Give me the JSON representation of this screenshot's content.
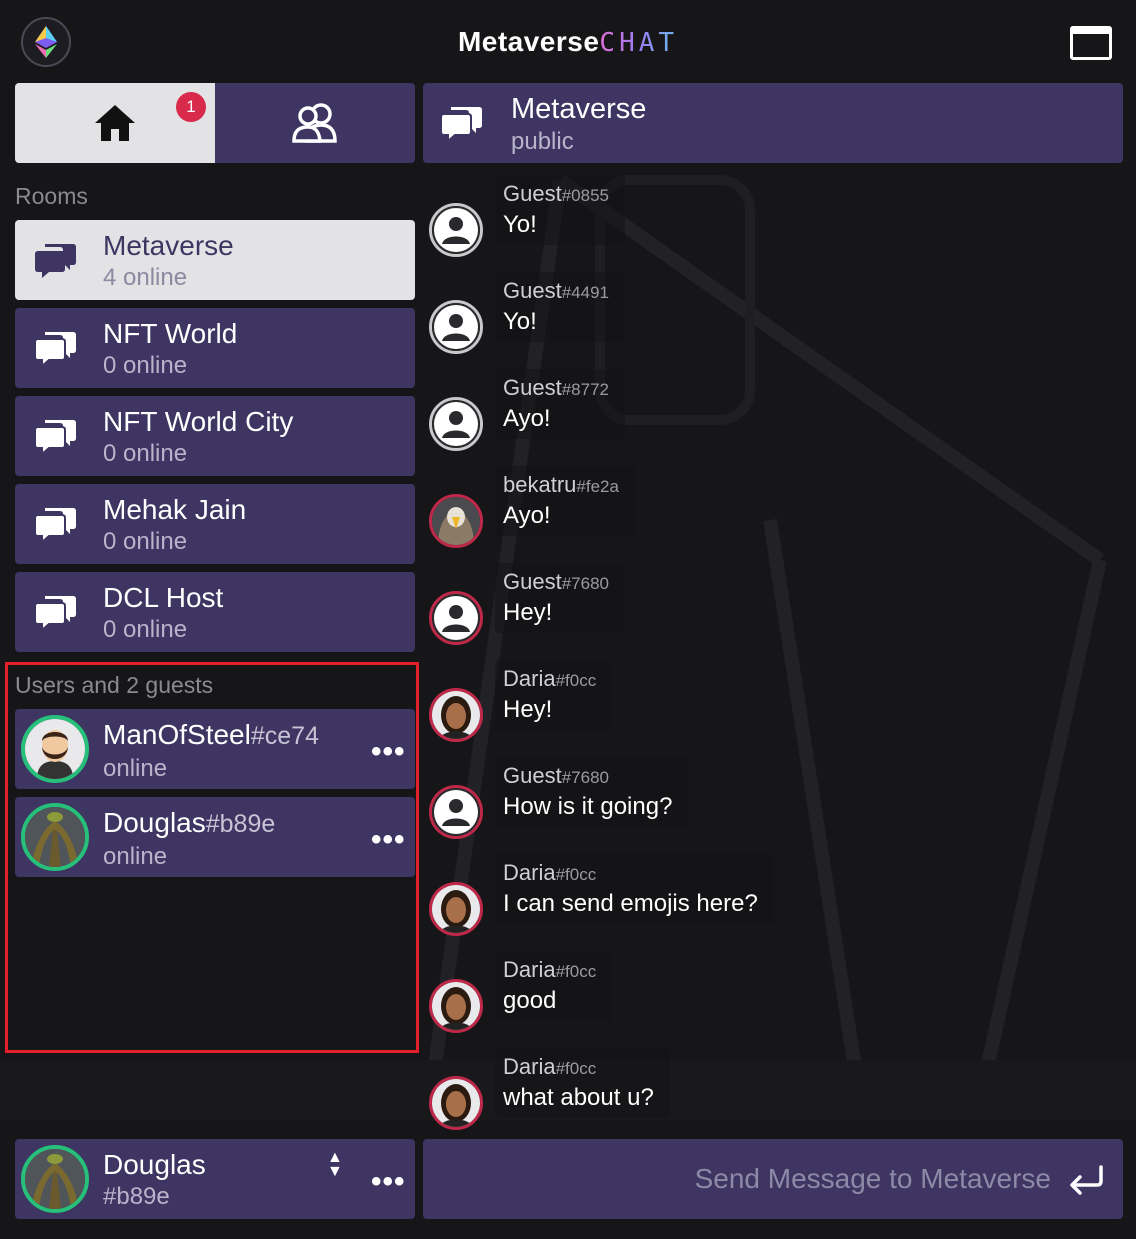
{
  "header": {
    "title_main": "Metaverse",
    "title_accent": "CHAT"
  },
  "nav": {
    "home_badge": "1"
  },
  "rooms": {
    "label": "Rooms",
    "items": [
      {
        "name": "Metaverse",
        "status": "4 online"
      },
      {
        "name": "NFT World",
        "status": "0 online"
      },
      {
        "name": "NFT World City",
        "status": "0 online"
      },
      {
        "name": "Mehak Jain",
        "status": "0 online"
      },
      {
        "name": "DCL Host",
        "status": "0 online"
      }
    ]
  },
  "users": {
    "label": "Users and 2 guests",
    "items": [
      {
        "name": "ManOfSteel",
        "tag": "#ce74",
        "status": "online",
        "menu": "•••"
      },
      {
        "name": "Douglas",
        "tag": "#b89e",
        "status": "online",
        "menu": "•••"
      }
    ]
  },
  "current_user": {
    "name": "Douglas",
    "tag": "#b89e",
    "menu": "•••"
  },
  "chat": {
    "room_name": "Metaverse",
    "room_type": "public",
    "messages": [
      {
        "author": "Guest",
        "tag": "#0855",
        "text": "Yo!"
      },
      {
        "author": "Guest",
        "tag": "#4491",
        "text": "Yo!"
      },
      {
        "author": "Guest",
        "tag": "#8772",
        "text": "Ayo!"
      },
      {
        "author": "bekatru",
        "tag": "#fe2a",
        "text": "Ayo!"
      },
      {
        "author": "Guest",
        "tag": "#7680",
        "text": "Hey!"
      },
      {
        "author": "Daria",
        "tag": "#f0cc",
        "text": "Hey!"
      },
      {
        "author": "Guest",
        "tag": "#7680",
        "text": "How is it going?"
      },
      {
        "author": "Daria",
        "tag": "#f0cc",
        "text": "I can  send emojis here?"
      },
      {
        "author": "Daria",
        "tag": "#f0cc",
        "text": "good"
      },
      {
        "author": "Daria",
        "tag": "#f0cc",
        "text": "what about  u?"
      }
    ],
    "composer_placeholder": "Send Message to Metaverse"
  },
  "colors": {
    "panel": "#3e3562",
    "active_panel": "#e3e3e5",
    "online_ring": "#26c07a",
    "badge": "#d82a4b",
    "highlight_box": "#e3202c"
  }
}
